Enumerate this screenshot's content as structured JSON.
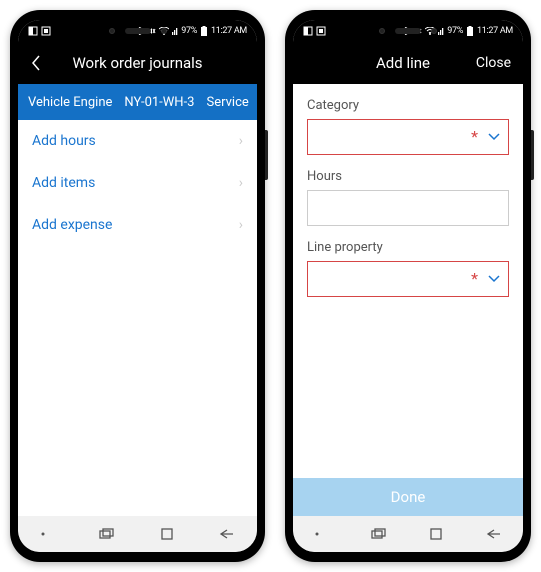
{
  "status": {
    "left_icons": "◧ ▣",
    "right_text": "✱ ✕ �務  ᯤ ⫿⫿⫿ 97% ▮ 11:27 AM"
  },
  "phone1": {
    "header": {
      "title": "Work order journals"
    },
    "infobar": {
      "col1": "Vehicle Engine",
      "col2": "NY-01-WH-3",
      "col3": "Service"
    },
    "rows": [
      {
        "label": "Add hours"
      },
      {
        "label": "Add items"
      },
      {
        "label": "Add expense"
      }
    ]
  },
  "phone2": {
    "header": {
      "title": "Add line",
      "close": "Close"
    },
    "fields": {
      "category_label": "Category",
      "hours_label": "Hours",
      "lineprop_label": "Line property"
    },
    "done": "Done"
  }
}
